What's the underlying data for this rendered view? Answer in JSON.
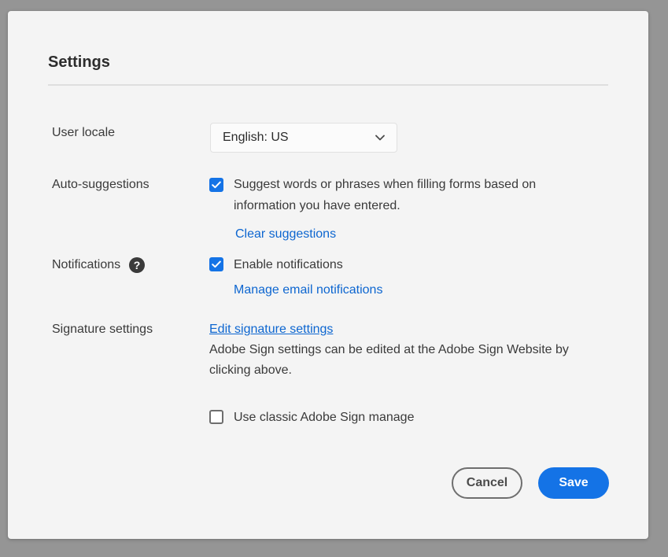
{
  "dialog": {
    "title": "Settings"
  },
  "colors": {
    "accent": "#1473e6",
    "link": "#0d66d0",
    "background": "#f4f4f4"
  },
  "user_locale": {
    "label": "User locale",
    "selected": "English: US",
    "icon": "chevron-down-icon"
  },
  "auto_suggestions": {
    "label": "Auto-suggestions",
    "checked": true,
    "text_line1": "Suggest words or phrases when filling forms based on",
    "text_line2": "information you have entered.",
    "clear_link": "Clear suggestions"
  },
  "notifications": {
    "label": "Notifications",
    "help_icon": "help-icon",
    "help_glyph": "?",
    "checked": true,
    "enable_text": "Enable notifications",
    "manage_link": "Manage email notifications"
  },
  "signature": {
    "label": "Signature settings",
    "edit_link": "Edit signature settings",
    "info_line1": "Adobe Sign settings can be edited at the Adobe Sign Website by",
    "info_line2": "clicking above.",
    "classic_checked": false,
    "classic_text": "Use classic Adobe Sign manage"
  },
  "footer": {
    "cancel_label": "Cancel",
    "save_label": "Save"
  }
}
